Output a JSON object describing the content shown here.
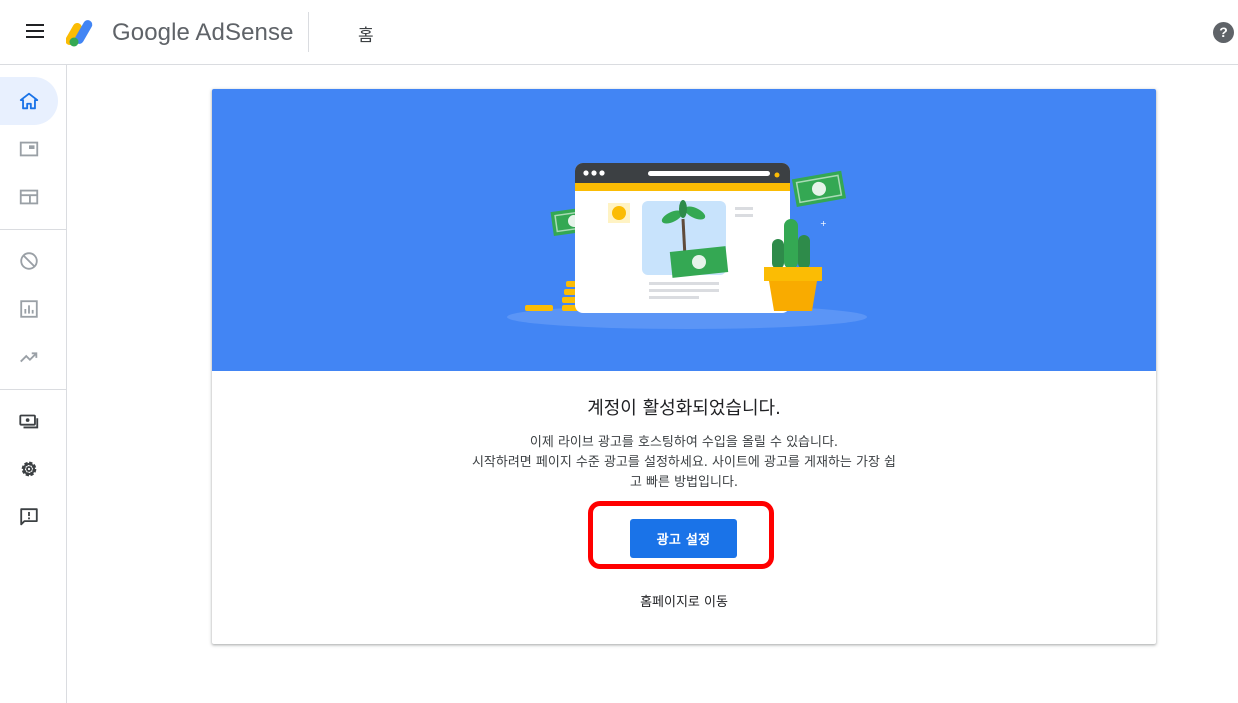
{
  "header": {
    "brand": "Google AdSense",
    "page_title": "홈",
    "help_label": "?"
  },
  "sidebar": {
    "items": [
      {
        "name": "home",
        "icon": "home-icon",
        "active": true
      },
      {
        "name": "ads",
        "icon": "ads-icon",
        "active": false
      },
      {
        "name": "sites",
        "icon": "sites-icon",
        "active": false
      },
      {
        "name": "blocking-controls",
        "icon": "block-icon",
        "active": false
      },
      {
        "name": "reports",
        "icon": "reports-icon",
        "active": false
      },
      {
        "name": "optimization",
        "icon": "trending-icon",
        "active": false
      },
      {
        "name": "payments",
        "icon": "payments-icon",
        "active": false
      },
      {
        "name": "settings",
        "icon": "gear-icon",
        "active": false
      },
      {
        "name": "feedback",
        "icon": "feedback-icon",
        "active": false
      }
    ]
  },
  "card": {
    "title": "계정이 활성화되었습니다.",
    "description_lines": [
      "이제 라이브 광고를 호스팅하여 수입을 올릴 수 있습니다.",
      "시작하려면 페이지 수준 광고를 설정하세요. 사이트에 광고를 게재하는 가장 쉽",
      "고 빠른 방법입니다."
    ],
    "primary_button": "광고 설정",
    "secondary_link": "홈페이지로 이동"
  },
  "colors": {
    "accent": "#1a73e8",
    "hero_background": "#4285f4",
    "highlight": "#ff0000"
  }
}
